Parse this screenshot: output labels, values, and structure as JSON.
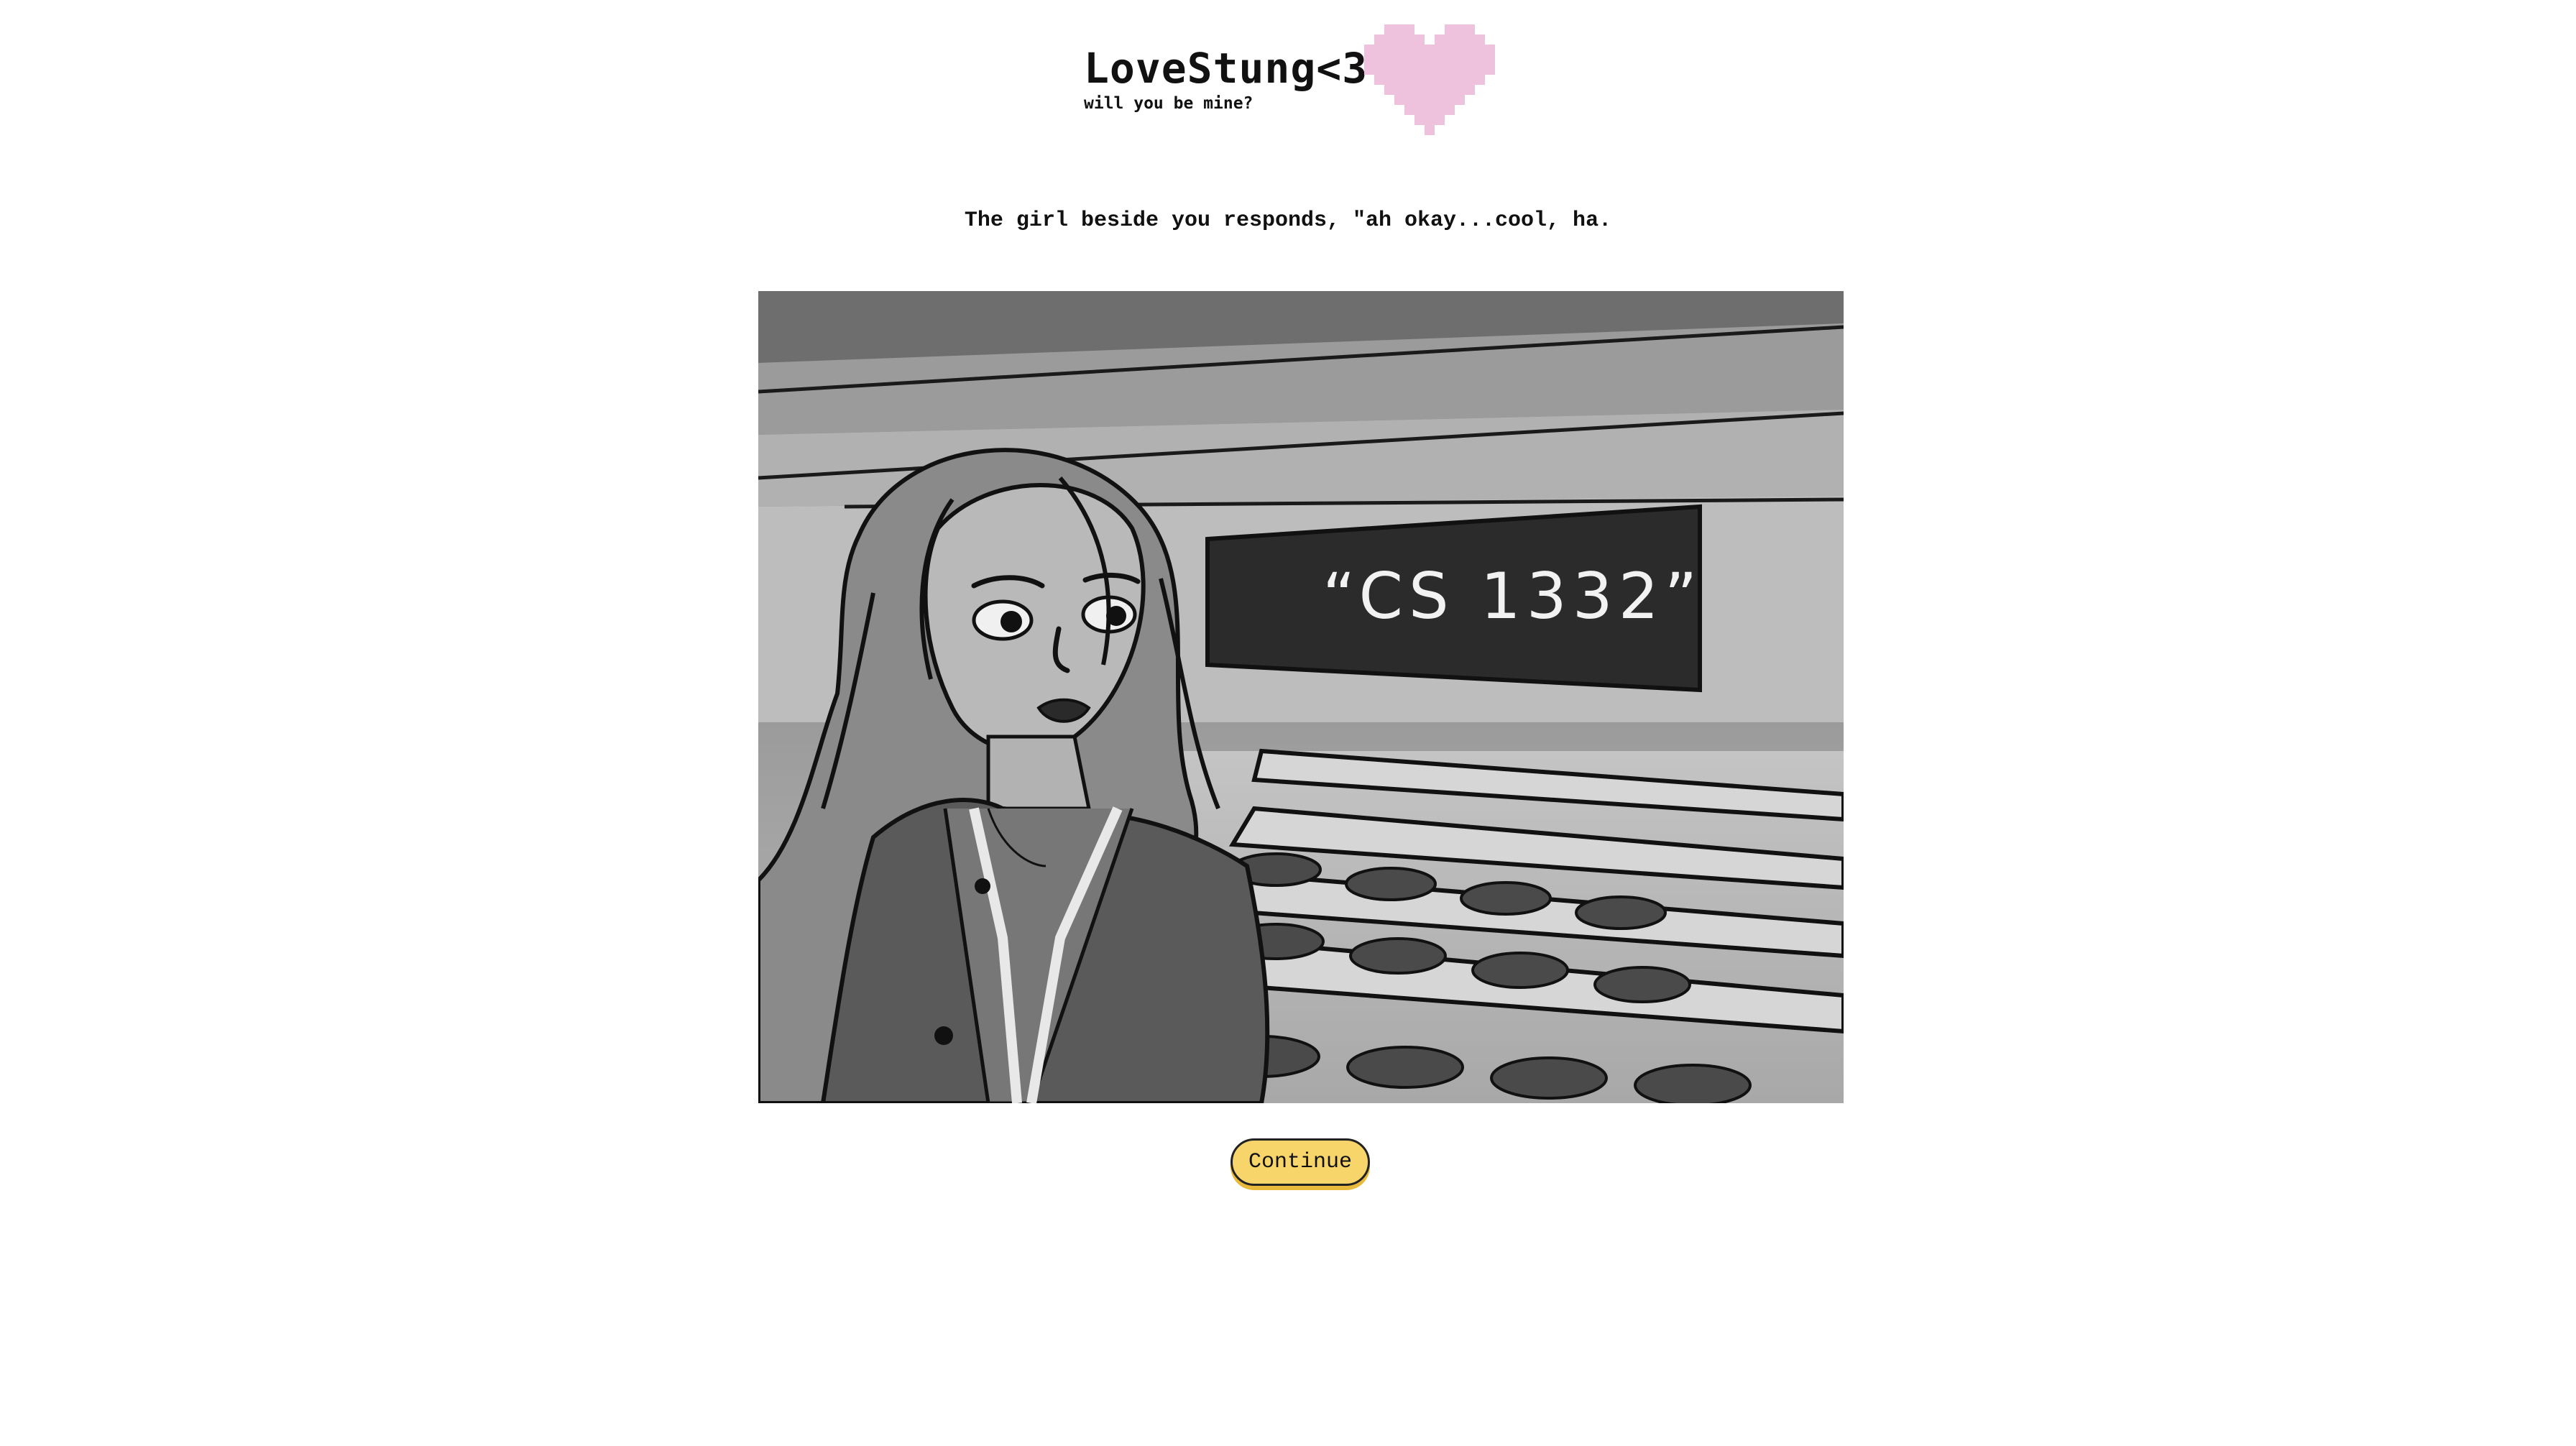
{
  "header": {
    "title": "LoveStung<3",
    "tagline": "will you be mine?",
    "heart_color": "#eec1dc"
  },
  "narration": {
    "text": "The girl beside you responds, \"ah okay...cool, ha."
  },
  "scene": {
    "chalkboard_text": "“CS 1332”"
  },
  "actions": {
    "continue_label": "Continue"
  },
  "colors": {
    "button_fill": "#f7d56b",
    "button_shadow": "#e9b93c",
    "text": "#111111"
  }
}
